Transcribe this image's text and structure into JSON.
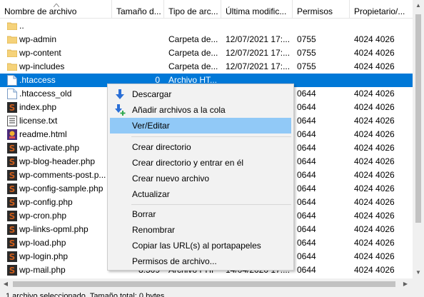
{
  "columns": {
    "name": "Nombre de archivo",
    "size": "Tamaño d...",
    "type": "Tipo de arc...",
    "date": "Última modific...",
    "perm": "Permisos",
    "owner": "Propietario/..."
  },
  "files": [
    {
      "name": "..",
      "size": "",
      "type": "",
      "date": "",
      "perm": "",
      "owner": "",
      "icon": "folder-icon"
    },
    {
      "name": "wp-admin",
      "size": "",
      "type": "Carpeta de...",
      "date": "12/07/2021 17:...",
      "perm": "0755",
      "owner": "4024 4026",
      "icon": "folder-icon"
    },
    {
      "name": "wp-content",
      "size": "",
      "type": "Carpeta de...",
      "date": "12/07/2021 17:...",
      "perm": "0755",
      "owner": "4024 4026",
      "icon": "folder-icon"
    },
    {
      "name": "wp-includes",
      "size": "",
      "type": "Carpeta de...",
      "date": "12/07/2021 17:...",
      "perm": "0755",
      "owner": "4024 4026",
      "icon": "folder-icon"
    },
    {
      "name": ".htaccess",
      "size": "0",
      "type": "Archivo HT...",
      "date": "",
      "perm": "",
      "owner": "",
      "icon": "file-icon",
      "selected": true
    },
    {
      "name": ".htaccess_old",
      "size": "",
      "type": "",
      "date": "",
      "perm": "0644",
      "owner": "4024 4026",
      "icon": "file-icon"
    },
    {
      "name": "index.php",
      "size": "",
      "type": "",
      "date": "",
      "perm": "0644",
      "owner": "4024 4026",
      "icon": "php-file-icon"
    },
    {
      "name": "license.txt",
      "size": "",
      "type": "",
      "date": "",
      "perm": "0644",
      "owner": "4024 4026",
      "icon": "text-file-icon"
    },
    {
      "name": "readme.html",
      "size": "",
      "type": "",
      "date": "",
      "perm": "0644",
      "owner": "4024 4026",
      "icon": "html-file-icon"
    },
    {
      "name": "wp-activate.php",
      "size": "",
      "type": "",
      "date": "",
      "perm": "0644",
      "owner": "4024 4026",
      "icon": "php-file-icon"
    },
    {
      "name": "wp-blog-header.php",
      "size": "",
      "type": "",
      "date": "",
      "perm": "0644",
      "owner": "4024 4026",
      "icon": "php-file-icon"
    },
    {
      "name": "wp-comments-post.p...",
      "size": "",
      "type": "",
      "date": "",
      "perm": "0644",
      "owner": "4024 4026",
      "icon": "php-file-icon"
    },
    {
      "name": "wp-config-sample.php",
      "size": "",
      "type": "",
      "date": "",
      "perm": "0644",
      "owner": "4024 4026",
      "icon": "php-file-icon"
    },
    {
      "name": "wp-config.php",
      "size": "",
      "type": "",
      "date": "",
      "perm": "0644",
      "owner": "4024 4026",
      "icon": "php-file-icon"
    },
    {
      "name": "wp-cron.php",
      "size": "",
      "type": "",
      "date": "",
      "perm": "0644",
      "owner": "4024 4026",
      "icon": "php-file-icon"
    },
    {
      "name": "wp-links-opml.php",
      "size": "",
      "type": "",
      "date": "",
      "perm": "0644",
      "owner": "4024 4026",
      "icon": "php-file-icon"
    },
    {
      "name": "wp-load.php",
      "size": "",
      "type": "",
      "date": "",
      "perm": "0644",
      "owner": "4024 4026",
      "icon": "php-file-icon"
    },
    {
      "name": "wp-login.php",
      "size": "",
      "type": "",
      "date": "",
      "perm": "0644",
      "owner": "4024 4026",
      "icon": "php-file-icon"
    },
    {
      "name": "wp-mail.php",
      "size": "8.509",
      "type": "Archivo PHP",
      "date": "14/04/2020 17:...",
      "perm": "0644",
      "owner": "4024 4026",
      "icon": "php-file-icon"
    }
  ],
  "context_menu": {
    "download": "Descargar",
    "add_to_queue": "Añadir archivos a la cola",
    "view_edit": "Ver/Editar",
    "create_dir": "Crear directorio",
    "create_dir_enter": "Crear directorio y entrar en él",
    "create_file": "Crear nuevo archivo",
    "refresh": "Actualizar",
    "delete": "Borrar",
    "rename": "Renombrar",
    "copy_urls": "Copiar las URL(s) al portapapeles",
    "permissions": "Permisos de archivo..."
  },
  "status_text": "1 archivo seleccionado. Tamaño total: 0 bytes",
  "colors": {
    "selection": "#0078d7",
    "menu_highlight": "#91c9f7",
    "php_icon": "#c95b1a",
    "folder": "#f5d27a"
  }
}
